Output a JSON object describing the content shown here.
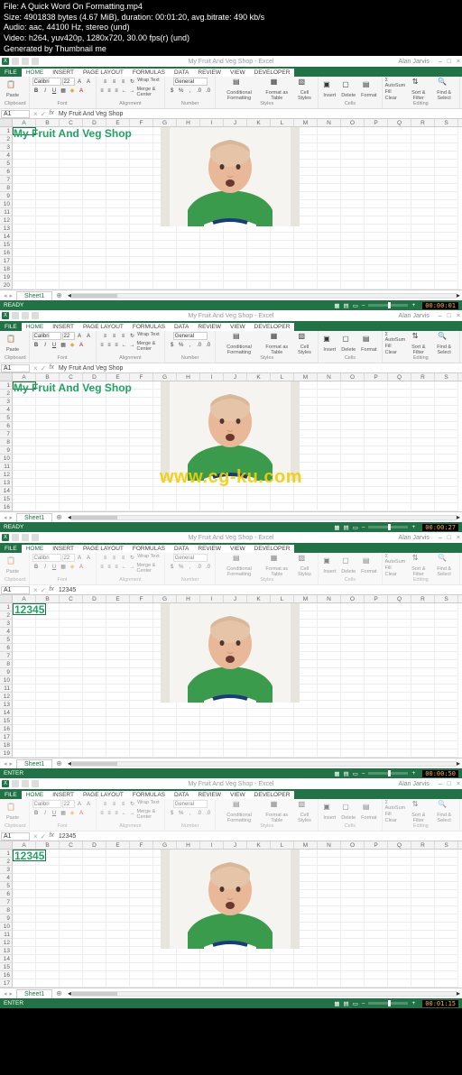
{
  "file_info": {
    "file": "File: A Quick Word On Formatting.mp4",
    "size": "Size: 4901838 bytes (4.67 MiB), duration: 00:01:20, avg.bitrate: 490 kb/s",
    "audio": "Audio: aac, 44100 Hz, stereo (und)",
    "video": "Video: h264, yuv420p, 1280x720, 30.00 fps(r) (und)",
    "generated": "Generated by Thumbnail me"
  },
  "watermark": "www.cg-ku.com",
  "ribbon": {
    "file": "FILE",
    "tabs": [
      "HOME",
      "INSERT",
      "PAGE LAYOUT",
      "FORMULAS",
      "DATA",
      "REVIEW",
      "VIEW",
      "DEVELOPER"
    ],
    "user": "Alan Jarvis",
    "groups": {
      "clipboard": "Clipboard",
      "paste": "Paste",
      "font": "Font",
      "font_name": "Calibri",
      "font_size": "22",
      "alignment": "Alignment",
      "wrap": "Wrap Text",
      "merge": "Merge & Center",
      "number": "Number",
      "general": "General",
      "styles": "Styles",
      "cond": "Conditional Formatting",
      "fmt_table": "Format as Table",
      "cell_styles": "Cell Styles",
      "cells": "Cells",
      "insert": "Insert",
      "delete": "Delete",
      "format": "Format",
      "editing": "Editing",
      "autosum": "AutoSum",
      "fill": "Fill",
      "clear": "Clear",
      "sort": "Sort & Filter",
      "find": "Find & Select"
    }
  },
  "title": "My Fruit And Veg Shop - Excel",
  "cols": [
    "A",
    "B",
    "C",
    "D",
    "E",
    "F",
    "G",
    "H",
    "I",
    "J",
    "K",
    "L",
    "M",
    "N",
    "O",
    "P",
    "Q",
    "R",
    "S"
  ],
  "panel0": {
    "namebox": "A1",
    "formula": "My Fruit And Veg Shop",
    "a1": "My Fruit And Veg Shop",
    "row_start": 1,
    "row_end": 20,
    "status": "READY",
    "timecode": "00:00:01",
    "editing": false
  },
  "panel1": {
    "namebox": "A1",
    "formula": "My Fruit And Veg Shop",
    "a1": "My Fruit And Veg Shop",
    "row_start": 1,
    "row_end": 16,
    "status": "READY",
    "timecode": "00:00:27",
    "editing": false
  },
  "panel2": {
    "namebox": "A1",
    "formula": "12345",
    "a1": "12345",
    "row_start": 1,
    "row_end": 19,
    "status": "ENTER",
    "timecode": "00:00:50",
    "editing": true
  },
  "panel3": {
    "namebox": "A1",
    "formula": "12345",
    "a1": "12345",
    "row_start": 1,
    "row_end": 17,
    "status": "ENTER",
    "timecode": "00:01:15",
    "editing": true
  },
  "sheet_tab": "Sheet1"
}
